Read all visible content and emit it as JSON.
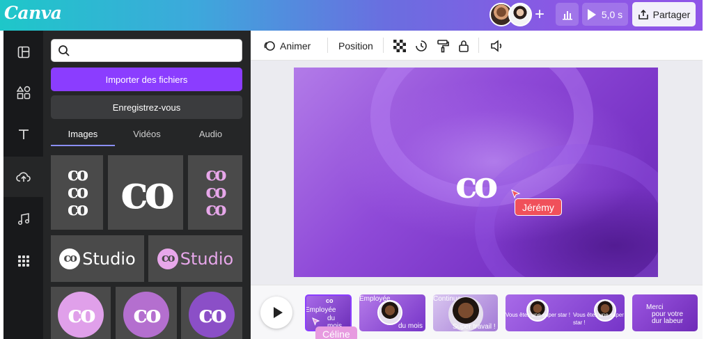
{
  "header": {
    "logo": "Canva",
    "play_duration": "5,0 s",
    "share_label": "Partager"
  },
  "rail": {
    "items": [
      "layout-icon",
      "shapes-icon",
      "text-icon",
      "upload-icon",
      "music-icon",
      "apps-icon"
    ]
  },
  "panel": {
    "search_placeholder": "",
    "import_label": "Importer des fichiers",
    "signup_label": "Enregistrez-vous",
    "tabs": [
      "Images",
      "Vidéos",
      "Audio"
    ],
    "active_tab": "Images",
    "tiles": [
      {
        "text": "co\nco\nco",
        "style": "white-on-gray"
      },
      {
        "text": "co",
        "style": "white-large"
      },
      {
        "text": "co\nco\nco",
        "style": "pink-on-gray"
      },
      {
        "text": "Studio",
        "prefix": "co",
        "style": "white"
      },
      {
        "text": "Studio",
        "prefix": "co",
        "style": "pink"
      },
      {
        "text": "co",
        "style": "pink-circle"
      },
      {
        "text": "co",
        "style": "mauve-circle"
      },
      {
        "text": "co",
        "style": "purple-circle"
      }
    ]
  },
  "toolbar": {
    "animate_label": "Animer",
    "position_label": "Position"
  },
  "canvas": {
    "slide_logo": "co",
    "collaborator_tag": "Jérémy"
  },
  "timeline": {
    "thumbs": [
      {
        "lines": [
          "Employée",
          "du mois"
        ],
        "label": "co"
      },
      {
        "lines": [
          "Employée",
          "du mois"
        ]
      },
      {
        "lines": [
          "Continuez",
          "Super travail !"
        ]
      },
      {
        "lines": [
          "Vous êtes une super star !",
          "Vous êtes une super star !"
        ]
      },
      {
        "lines": [
          "Merci",
          "pour votre",
          "dur labeur"
        ]
      }
    ],
    "collaborator_tag": "Céline"
  },
  "colors": {
    "accent": "#8b3dff",
    "jeremy_tag": "#f0505a",
    "celine_tag": "#e79be0"
  }
}
